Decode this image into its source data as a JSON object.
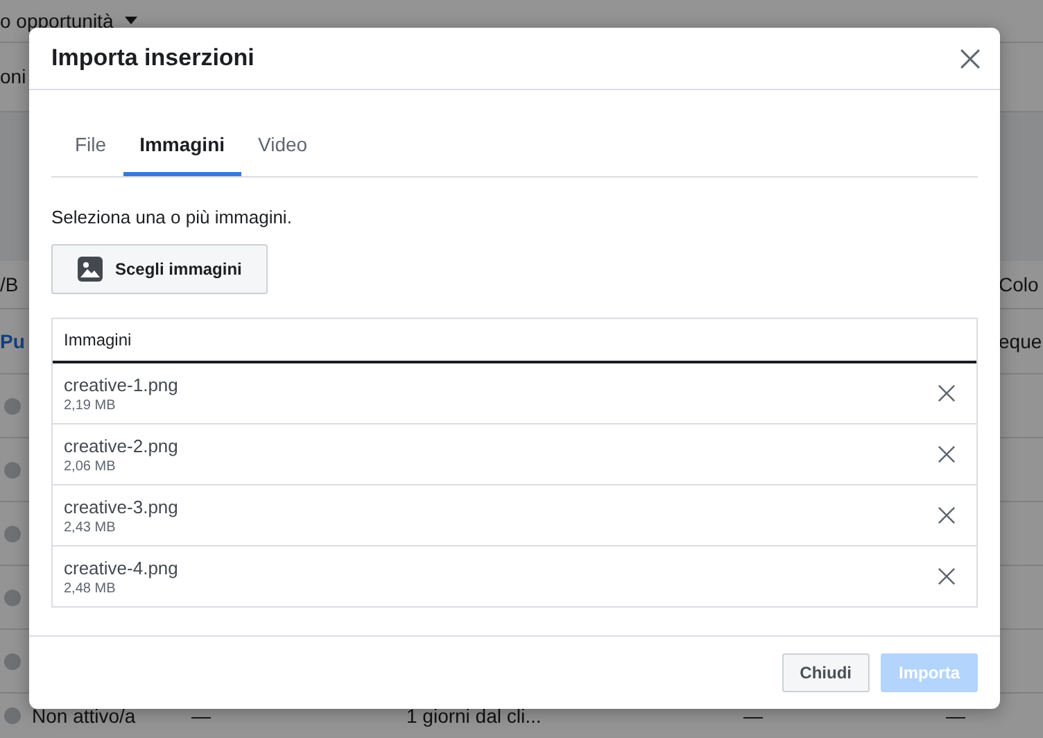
{
  "background": {
    "filter": "o opportunità",
    "rows": [
      {
        "kind": "plain",
        "cells": [
          "oni"
        ]
      },
      {
        "kind": "spacer",
        "cells": []
      },
      {
        "kind": "header",
        "cells": [
          "/B",
          "Colo"
        ]
      },
      {
        "kind": "link",
        "cells": [
          "Pu",
          "eque"
        ]
      },
      {
        "kind": "status",
        "cells": []
      },
      {
        "kind": "status",
        "cells": []
      },
      {
        "kind": "status",
        "cells": []
      },
      {
        "kind": "status",
        "cells": []
      },
      {
        "kind": "status",
        "cells": []
      },
      {
        "kind": "status",
        "cells": [
          "Non attivo/a",
          "—",
          "1 giorni dal cli...",
          "—",
          "—"
        ]
      }
    ]
  },
  "dialog": {
    "title": "Importa inserzioni",
    "tabs": [
      {
        "label": "File",
        "selected": false
      },
      {
        "label": "Immagini",
        "selected": true
      },
      {
        "label": "Video",
        "selected": false
      }
    ],
    "instruction": "Seleziona una o più immagini.",
    "choose_button": "Scegli immagini",
    "table": {
      "column": "Immagini",
      "rows": [
        {
          "name": "creative-1.png",
          "size": "2,19 MB"
        },
        {
          "name": "creative-2.png",
          "size": "2,06 MB"
        },
        {
          "name": "creative-3.png",
          "size": "2,43 MB"
        },
        {
          "name": "creative-4.png",
          "size": "2,48 MB"
        }
      ]
    },
    "buttons": [
      {
        "label": "Chiudi",
        "primary": false,
        "disabled": false
      },
      {
        "label": "Importa",
        "primary": true,
        "disabled": true
      }
    ]
  }
}
